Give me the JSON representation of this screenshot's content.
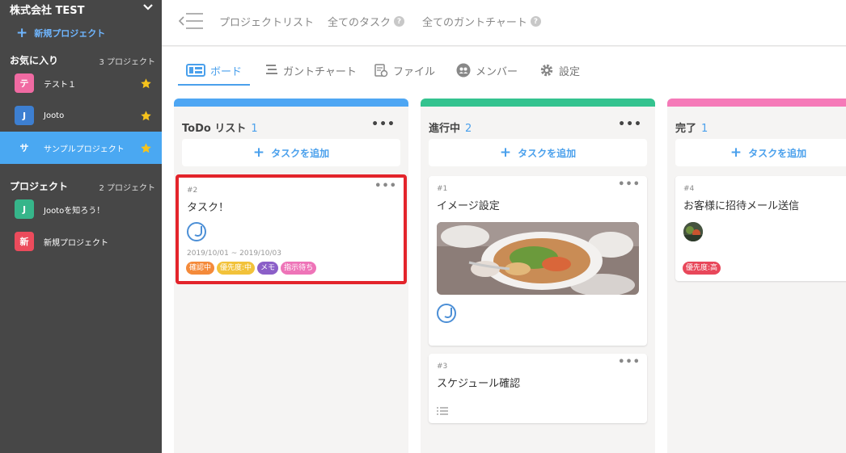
{
  "sidebar": {
    "company": "株式会社 TEST",
    "new_project": "新規プロジェクト",
    "favorites": {
      "title": "お気に入り",
      "count": "3 プロジェクト",
      "items": [
        {
          "badge": "テ",
          "label": "テスト１",
          "color": "#f06aa2"
        },
        {
          "badge": "J",
          "label": "Jooto",
          "color": "#3d7fd1"
        },
        {
          "badge": "サ",
          "label": "サンプルプロジェクト",
          "color": "#4aa8f2"
        }
      ]
    },
    "projects": {
      "title": "プロジェクト",
      "count": "2 プロジェクト",
      "items": [
        {
          "badge": "J",
          "label": "Jootoを知ろう！",
          "color": "#36b58a"
        },
        {
          "badge": "新",
          "label": "新規プロジェクト",
          "color": "#ec4b5c"
        }
      ]
    }
  },
  "header": {
    "links": [
      "プロジェクトリスト",
      "全てのタスク",
      "全てのガントチャート"
    ],
    "help": "?"
  },
  "tabs": [
    "ボード",
    "ガントチャート",
    "ファイル",
    "メンバー",
    "設定"
  ],
  "board": {
    "add_task": "タスクを追加",
    "columns": [
      {
        "title": "ToDo リスト",
        "count": "1",
        "color": "#4ea6f3",
        "cards": [
          {
            "num": "#2",
            "title": "タスク！",
            "dates": "2019/10/01 ~ 2019/10/03",
            "tags": [
              {
                "label": "確認中",
                "color": "#f48a3a"
              },
              {
                "label": "優先度:中",
                "color": "#f2c23a"
              },
              {
                "label": "メモ",
                "color": "#8b5fc8"
              },
              {
                "label": "指示待ち",
                "color": "#ee74b8"
              }
            ]
          }
        ]
      },
      {
        "title": "進行中",
        "count": "2",
        "color": "#34c38f",
        "cards": [
          {
            "num": "#1",
            "title": "イメージ設定"
          },
          {
            "num": "#3",
            "title": "スケジュール確認"
          }
        ]
      },
      {
        "title": "完了",
        "count": "1",
        "color": "#f57ab8",
        "cards": [
          {
            "num": "#4",
            "title": "お客様に招待メール送信",
            "tags": [
              {
                "label": "優先度:高",
                "color": "#e8475a"
              }
            ]
          }
        ]
      }
    ]
  }
}
